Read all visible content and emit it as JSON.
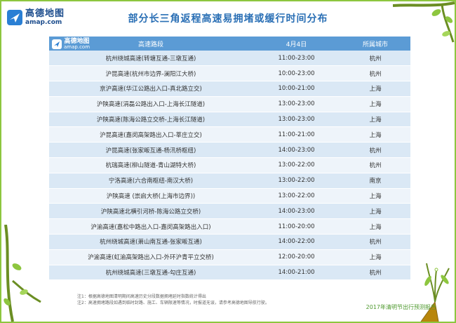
{
  "brand": {
    "name_cn": "高德地图",
    "name_en": "amap.com"
  },
  "title": "部分长三角返程高速易拥堵或缓行时间分布",
  "table": {
    "headers": {
      "road": "高速路段",
      "date": "4月4日",
      "city": "所属城市"
    },
    "rows": [
      {
        "road": "杭州绕城高速(转塘互通-三墩互通)",
        "time": "11:00-23:00",
        "city": "杭州"
      },
      {
        "road": "沪昆高速(杭州市边界-澜阳江大桥)",
        "time": "10:00-23:00",
        "city": "杭州"
      },
      {
        "road": "京沪高速(华江公路出入口-真北路立交)",
        "time": "10:00-21:00",
        "city": "上海"
      },
      {
        "road": "沪陕高速(涓磊公路出入口-上海长江隧道)",
        "time": "13:00-23:00",
        "city": "上海"
      },
      {
        "road": "沪陕高速(陈海公路立交桥-上海长江隧道)",
        "time": "13:00-23:00",
        "city": "上海"
      },
      {
        "road": "沪昆高速(嘉闵高架路出入口-莘庄立交)",
        "time": "11:00-21:00",
        "city": "上海"
      },
      {
        "road": "沪昆高速(张家畈互通-杨汛桥枢纽)",
        "time": "14:00-23:00",
        "city": "杭州"
      },
      {
        "road": "杭瑞高速(柳山隧道-青山湖特大桥)",
        "time": "13:00-22:00",
        "city": "杭州"
      },
      {
        "road": "宁洛高速(六合南枢纽-南汉大桥)",
        "time": "13:00-22:00",
        "city": "南京"
      },
      {
        "road": "沪陕高速 (崇启大桥(上海市边界))",
        "time": "13:00-22:00",
        "city": "上海"
      },
      {
        "road": "沪陕高速北横引河桥-陈海公路立交桥)",
        "time": "14:00-23:00",
        "city": "上海"
      },
      {
        "road": "沪渝高速(嘉松中路出入口-嘉闵高架路出入口)",
        "time": "11:00-20:00",
        "city": "上海"
      },
      {
        "road": "杭州绕城高速(萧山南互通-张家畈互通)",
        "time": "14:00-22:00",
        "city": "杭州"
      },
      {
        "road": "沪渝高速(虹渝高架路出入口-外环沪青平立交桥)",
        "time": "12:00-20:00",
        "city": "上海"
      },
      {
        "road": "杭州绕城高速(三墩互通-勾庄互通)",
        "time": "14:00-21:00",
        "city": "杭州"
      }
    ]
  },
  "notes": [
    "注1：根据高德地图清明期间高速历史分段数据拥堵延时指数统计得出",
    "注2：高速拥堵路段如遇到临时封路、施工、车辆限速等情况，时报道无误，请参考高德地图导航行驶。"
  ],
  "footer": "2017年清明节出行预测报告",
  "colors": {
    "header": "#5b9bd5",
    "row_odd": "#dae8f5",
    "row_even": "#eef4fa",
    "title": "#2a6fb5",
    "frame": "#8dc63f"
  }
}
